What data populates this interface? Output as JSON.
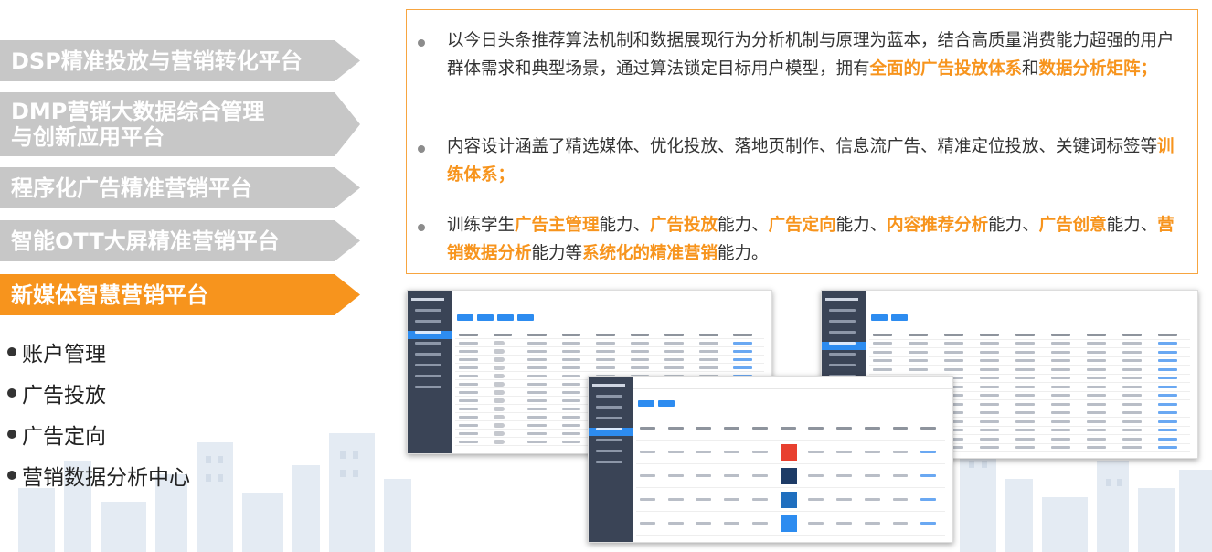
{
  "menu": {
    "items": [
      {
        "label": "DSP精准投放与营销转化平台",
        "state": "gray"
      },
      {
        "label": "DMP营销大数据综合管理与创新应用平台",
        "line1": "DMP营销大数据综合管理",
        "line2": "与创新应用平台",
        "state": "gray"
      },
      {
        "label": "程序化广告精准营销平台",
        "state": "gray"
      },
      {
        "label": "智能OTT大屏精准营销平台",
        "state": "gray"
      },
      {
        "label": "新媒体智慧营销平台",
        "state": "active"
      }
    ],
    "sub_items": [
      "账户管理",
      "广告投放",
      "广告定向",
      "营销数据分析中心"
    ]
  },
  "panel": {
    "p1": {
      "t1": "以今日头条推荐算法机制和数据展现行为分析机制与原理为蓝本，结合高质量消费能力超强的用户群体需求和典型场景，通过算法锁定目标用户模型，拥有",
      "h1": "全面的广告投放体系",
      "t2": "和",
      "h2": "数据分析矩阵；"
    },
    "p2": {
      "t1": "内容设计涵盖了精选媒体、优化投放、落地页制作、信息流广告、精准定位投放、关键词标签等",
      "h1": "训练体系；"
    },
    "p3": {
      "t1": "训练学生",
      "h1": "广告主管理",
      "t2": "能力、",
      "h2": "广告投放",
      "t3": "能力、",
      "h3": "广告定向",
      "t4": "能力、",
      "h4": "内容推荐分析",
      "t5": "能力、",
      "h5": "广告创意",
      "t6": "能力、",
      "h6": "营销数据分析",
      "t7": "能力等",
      "h7": "系统化的精准营销",
      "t8": "能力。"
    }
  },
  "colors": {
    "accent": "#f7941d",
    "menu_gray": "#c7c7c7",
    "sidebar": "#3a4456",
    "primary_blue": "#2d8cf0"
  }
}
